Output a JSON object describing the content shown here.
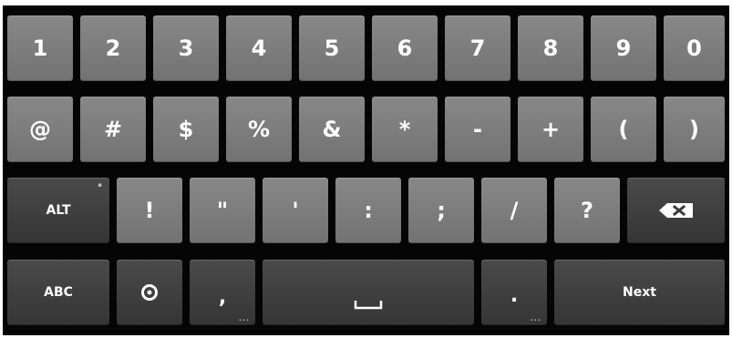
{
  "keyboard": {
    "row1": [
      "1",
      "2",
      "3",
      "4",
      "5",
      "6",
      "7",
      "8",
      "9",
      "0"
    ],
    "row2": [
      "@",
      "#",
      "$",
      "%",
      "&",
      "*",
      "-",
      "+",
      "(",
      ")"
    ],
    "row3": {
      "alt_label": "ALT",
      "symbols": [
        "!",
        "\"",
        "'",
        ":",
        ";",
        "/",
        "?"
      ],
      "backspace_icon": "backspace-icon"
    },
    "row4": {
      "abc_label": "ABC",
      "settings_icon": "gear-icon",
      "comma": ",",
      "space_icon": "space-icon",
      "period": ".",
      "next_label": "Next",
      "more_hint": "..."
    },
    "colors": {
      "background": "#050505",
      "light_key": "#808080",
      "dark_key": "#404040",
      "text": "#ffffff"
    }
  }
}
